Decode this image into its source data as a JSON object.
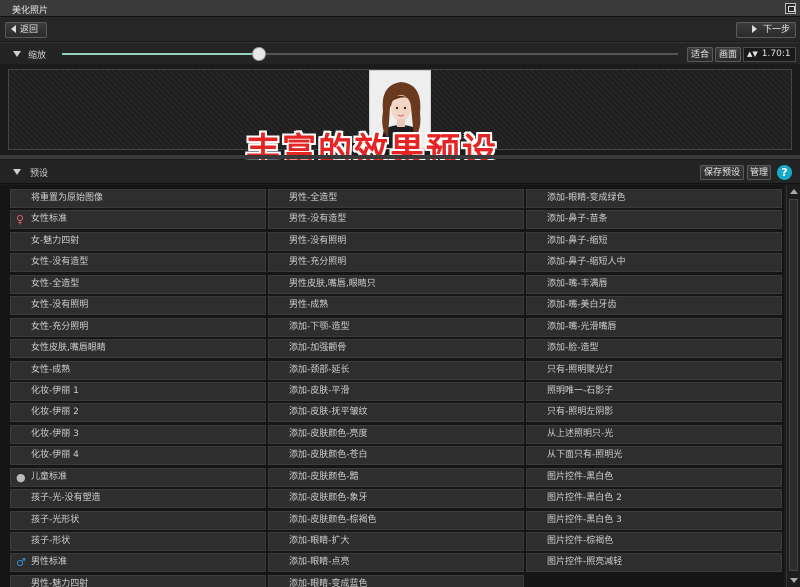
{
  "window": {
    "title": "美化照片"
  },
  "nav": {
    "back_label": "返回",
    "next_label": "下一步"
  },
  "zoom": {
    "label": "缩放",
    "level": 0.32,
    "fit_label": "适合",
    "page_label": "画面",
    "value": "1.70:1"
  },
  "overlay": {
    "caption": "丰富的效果预设"
  },
  "presets": {
    "label": "预设",
    "save_label": "保存预设",
    "manage_label": "管理",
    "help_label": "?",
    "col1": [
      {
        "label": "将重置为原始图像",
        "icon": ""
      },
      {
        "label": "女性标准",
        "icon": "female-icon"
      },
      {
        "label": "女-魅力四射",
        "icon": ""
      },
      {
        "label": "女性-没有造型",
        "icon": ""
      },
      {
        "label": "女性-全造型",
        "icon": ""
      },
      {
        "label": "女性-没有照明",
        "icon": ""
      },
      {
        "label": "女性-充分照明",
        "icon": ""
      },
      {
        "label": "女性皮肤,嘴唇眼睛",
        "icon": ""
      },
      {
        "label": "女性-成熟",
        "icon": ""
      },
      {
        "label": "化妆-伊丽 1",
        "icon": ""
      },
      {
        "label": "化妆-伊丽 2",
        "icon": ""
      },
      {
        "label": "化妆-伊丽 3",
        "icon": ""
      },
      {
        "label": "化妆-伊丽 4",
        "icon": ""
      },
      {
        "label": "儿童标准",
        "icon": "child-icon"
      },
      {
        "label": "孩子-光-没有塑造",
        "icon": ""
      },
      {
        "label": "孩子-光形状",
        "icon": ""
      },
      {
        "label": "孩子-形状",
        "icon": ""
      },
      {
        "label": "男性标准",
        "icon": "male-icon"
      },
      {
        "label": "男性-魅力四射",
        "icon": ""
      }
    ],
    "col2": [
      {
        "label": "男性-全造型"
      },
      {
        "label": "男性-没有造型"
      },
      {
        "label": "男性-没有照明"
      },
      {
        "label": "男性-充分照明"
      },
      {
        "label": "男性皮肤,嘴唇,眼睛只"
      },
      {
        "label": "男性-成熟"
      },
      {
        "label": "添加-下颚-造型"
      },
      {
        "label": "添加-加强颧骨"
      },
      {
        "label": "添加-颈部-延长"
      },
      {
        "label": "添加-皮肤-平滑"
      },
      {
        "label": "添加-皮肤-抚平皱纹"
      },
      {
        "label": "添加-皮肤颜色-亮度"
      },
      {
        "label": "添加-皮肤颜色-苍白"
      },
      {
        "label": "添加-皮肤颜色-黯"
      },
      {
        "label": "添加-皮肤颜色-象牙"
      },
      {
        "label": "添加-皮肤颜色-棕褐色"
      },
      {
        "label": "添加-眼睛-扩大"
      },
      {
        "label": "添加-眼睛-点亮"
      },
      {
        "label": "添加-眼睛-变成蓝色"
      }
    ],
    "col3": [
      {
        "label": "添加-眼睛-变成绿色"
      },
      {
        "label": "添加-鼻子-苗条"
      },
      {
        "label": "添加-鼻子-缩短"
      },
      {
        "label": "添加-鼻子-缩短人中"
      },
      {
        "label": "添加-嘴-丰满唇"
      },
      {
        "label": "添加-嘴-美白牙齿"
      },
      {
        "label": "添加-嘴-光滑嘴唇"
      },
      {
        "label": "添加-脸-造型"
      },
      {
        "label": "只有-照明聚光灯"
      },
      {
        "label": "照明唯一-石影子"
      },
      {
        "label": "只有-照明左阴影"
      },
      {
        "label": "从上述照明只-光"
      },
      {
        "label": "从下面只有-照明光"
      },
      {
        "label": "图片控件-黑白色"
      },
      {
        "label": "图片控件-黑白色 2"
      },
      {
        "label": "图片控件-黑白色 3"
      },
      {
        "label": "图片控件-棕褐色"
      },
      {
        "label": "图片控件-照亮减轻"
      }
    ]
  },
  "colors": {
    "accent": "#19a9c8",
    "overlay_text": "#e52424",
    "slider_fill": "#8fd0c0"
  }
}
